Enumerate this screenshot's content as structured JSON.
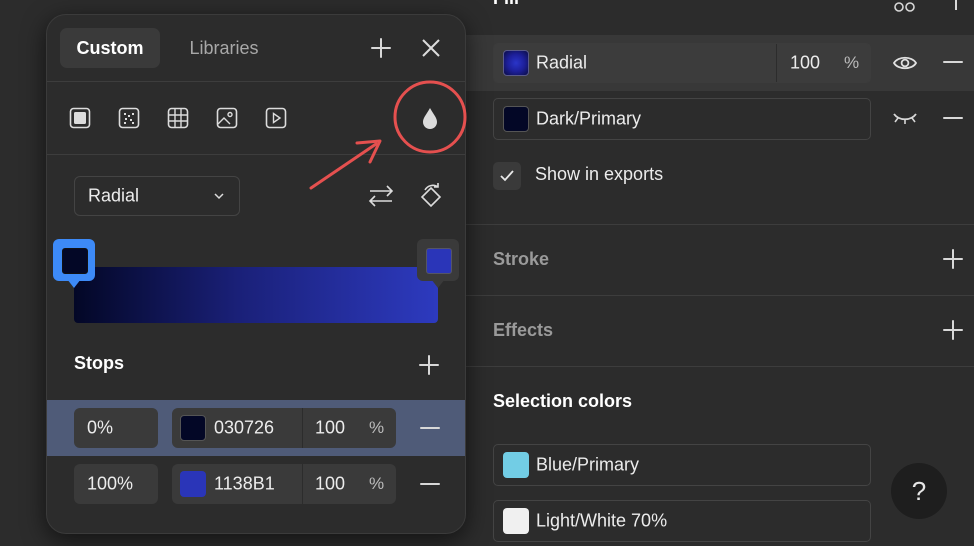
{
  "fill": {
    "title": "Fill",
    "layers": [
      {
        "label": "Radial",
        "opacity": "100",
        "unit": "%",
        "visible": true,
        "swatch": "#1d1f9a"
      },
      {
        "label": "Dark/Primary",
        "visible": false,
        "swatch": "#030726"
      }
    ],
    "show_in_exports": "Show in exports",
    "show_in_exports_checked": true
  },
  "stroke": {
    "title": "Stroke"
  },
  "effects": {
    "title": "Effects"
  },
  "selection_colors": {
    "title": "Selection colors",
    "items": [
      {
        "label": "Blue/Primary",
        "swatch": "#72cde5"
      },
      {
        "label": "Light/White 70%",
        "swatch": "#f0f0f0"
      }
    ]
  },
  "help": {
    "label": "?"
  },
  "picker": {
    "tabs": [
      {
        "label": "Custom",
        "active": true
      },
      {
        "label": "Libraries",
        "active": false
      }
    ],
    "fill_types": [
      "solid-fill-icon",
      "noise-fill-icon",
      "pattern-fill-icon",
      "image-fill-icon",
      "video-fill-icon"
    ],
    "gradient_type": "Radial",
    "gradient": {
      "start": "#030726",
      "end": "#2d3abf"
    },
    "stops_title": "Stops",
    "stops": [
      {
        "position": "0%",
        "hex": "030726",
        "swatch": "#030726",
        "opacity": "100",
        "unit": "%",
        "selected": true
      },
      {
        "position": "100%",
        "hex": "1138B1",
        "swatch": "#2a35b8",
        "opacity": "100",
        "unit": "%",
        "selected": false
      }
    ]
  },
  "annotation": {
    "color": "#e5504f"
  }
}
